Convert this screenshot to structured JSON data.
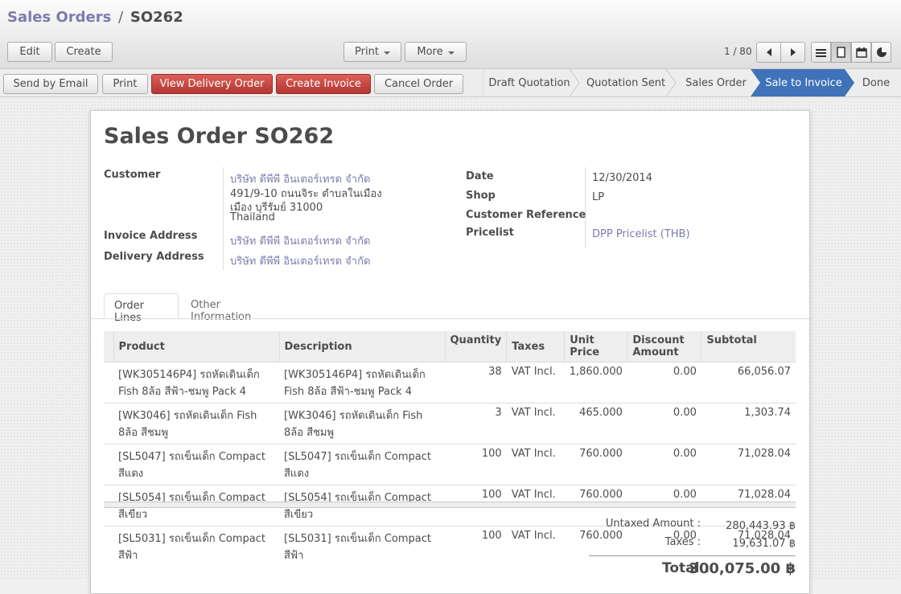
{
  "breadcrumb": {
    "parent": "Sales Orders",
    "separator": "/",
    "current": "SO262"
  },
  "toolbar": {
    "edit": "Edit",
    "create": "Create",
    "print": "Print",
    "more": "More",
    "pager": "1 / 80"
  },
  "actions": {
    "send_email": "Send by Email",
    "print": "Print",
    "view_delivery": "View Delivery Order",
    "create_invoice": "Create Invoice",
    "cancel_order": "Cancel Order"
  },
  "stages": [
    "Draft Quotation",
    "Quotation Sent",
    "Sales Order",
    "Sale to Invoice",
    "Done"
  ],
  "active_stage": "Sale to Invoice",
  "form": {
    "title_prefix": "Sales Order",
    "number": "SO262",
    "customer_label": "Customer",
    "customer_name": "บริษัท ดีพีพี อินเตอร์เทรด จำกัด",
    "customer_addr1": "491/9-10 ถนนจิระ ตำบลในเมือง",
    "customer_addr2": "เมือง บุรีรัมย์ 31000",
    "customer_country": "Thailand",
    "invoice_label": "Invoice Address",
    "invoice_value": "บริษัท ดีพีพี อินเตอร์เทรด จำกัด",
    "delivery_label": "Delivery Address",
    "delivery_value": "บริษัท ดีพีพี อินเตอร์เทรด จำกัด",
    "date_label": "Date",
    "date_value": "12/30/2014",
    "shop_label": "Shop",
    "shop_value": "LP",
    "custref_label": "Customer Reference",
    "pricelist_label": "Pricelist",
    "pricelist_value": "DPP Pricelist (THB)"
  },
  "tabs": {
    "order_lines": "Order Lines",
    "other_info": "Other Information"
  },
  "table": {
    "headers": {
      "product": "Product",
      "description": "Description",
      "quantity": "Quantity",
      "taxes": "Taxes",
      "unit_price": "Unit Price",
      "discount_1": "Discount",
      "discount_2": "Amount",
      "subtotal": "Subtotal"
    },
    "rows": [
      {
        "product": "[WK305146P4] รถหัดเดินเด็ก Fish 8ล้อ สีฟ้า-ชมพู Pack 4",
        "description": "[WK305146P4] รถหัดเดินเด็ก Fish 8ล้อ สีฟ้า-ชมพู Pack 4",
        "quantity": "38",
        "taxes": "VAT Incl.",
        "unit_price": "1,860.000",
        "discount": "0.00",
        "subtotal": "66,056.07"
      },
      {
        "product": "[WK3046] รถหัดเดินเด็ก Fish 8ล้อ สีชมพู",
        "description": "[WK3046] รถหัดเดินเด็ก Fish 8ล้อ สีชมพู",
        "quantity": "3",
        "taxes": "VAT Incl.",
        "unit_price": "465.000",
        "discount": "0.00",
        "subtotal": "1,303.74"
      },
      {
        "product": "[SL5047] รถเข็นเด็ก Compact สีแดง",
        "description": "[SL5047] รถเข็นเด็ก Compact สีแดง",
        "quantity": "100",
        "taxes": "VAT Incl.",
        "unit_price": "760.000",
        "discount": "0.00",
        "subtotal": "71,028.04"
      },
      {
        "product": "[SL5054] รถเข็นเด็ก Compact สีเขียว",
        "description": "[SL5054] รถเข็นเด็ก Compact สีเขียว",
        "quantity": "100",
        "taxes": "VAT Incl.",
        "unit_price": "760.000",
        "discount": "0.00",
        "subtotal": "71,028.04"
      },
      {
        "product": "[SL5031] รถเข็นเด็ก Compact สีฟ้า",
        "description": "[SL5031] รถเข็นเด็ก Compact สีฟ้า",
        "quantity": "100",
        "taxes": "VAT Incl.",
        "unit_price": "760.000",
        "discount": "0.00",
        "subtotal": "71,028.04"
      }
    ]
  },
  "totals": {
    "untaxed_label": "Untaxed Amount :",
    "untaxed_value": "280,443.93 ฿",
    "taxes_label": "Taxes :",
    "taxes_value": "19,631.07 ฿",
    "total_label": "Total :",
    "total_value": "300,075.00 ฿"
  },
  "colors": {
    "accent_red": "#c0392b",
    "active_stage": "#3f72b8",
    "link": "#7c7bad"
  },
  "icons": [
    "prev-icon",
    "next-icon",
    "list-view-icon",
    "form-view-icon",
    "calendar-view-icon",
    "graph-view-icon"
  ]
}
